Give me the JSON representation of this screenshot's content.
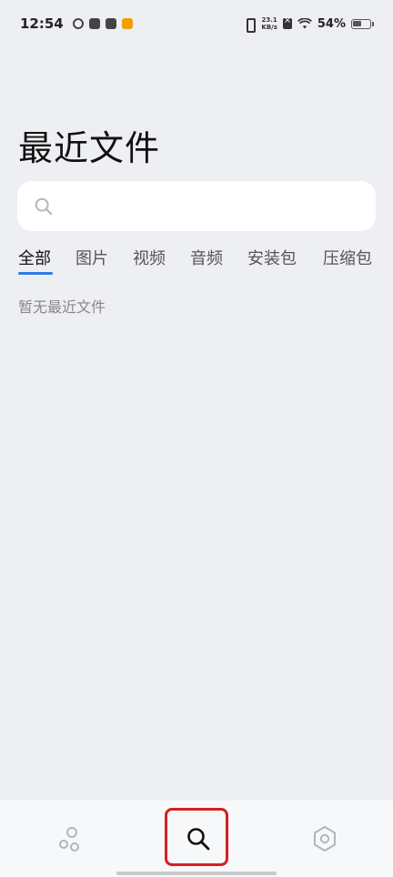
{
  "status_bar": {
    "time": "12:54",
    "net_speed_value": "23.1",
    "net_speed_unit": "KB/s",
    "battery": "54%",
    "battery_level": 0.54
  },
  "page": {
    "title": "最近文件",
    "search_placeholder": ""
  },
  "tabs": [
    {
      "label": "全部",
      "active": true
    },
    {
      "label": "图片",
      "active": false
    },
    {
      "label": "视频",
      "active": false
    },
    {
      "label": "音频",
      "active": false
    },
    {
      "label": "安装包",
      "active": false
    },
    {
      "label": "压缩包",
      "active": false
    }
  ],
  "empty_message": "暂无最近文件",
  "bottom_nav": {
    "items": [
      {
        "icon": "bubbles-icon",
        "active": false
      },
      {
        "icon": "search-icon",
        "active": true
      },
      {
        "icon": "settings-hexagon-icon",
        "active": false
      }
    ]
  },
  "colors": {
    "background": "#eeeff3",
    "accent": "#2f7be8",
    "highlight": "#d42020"
  }
}
